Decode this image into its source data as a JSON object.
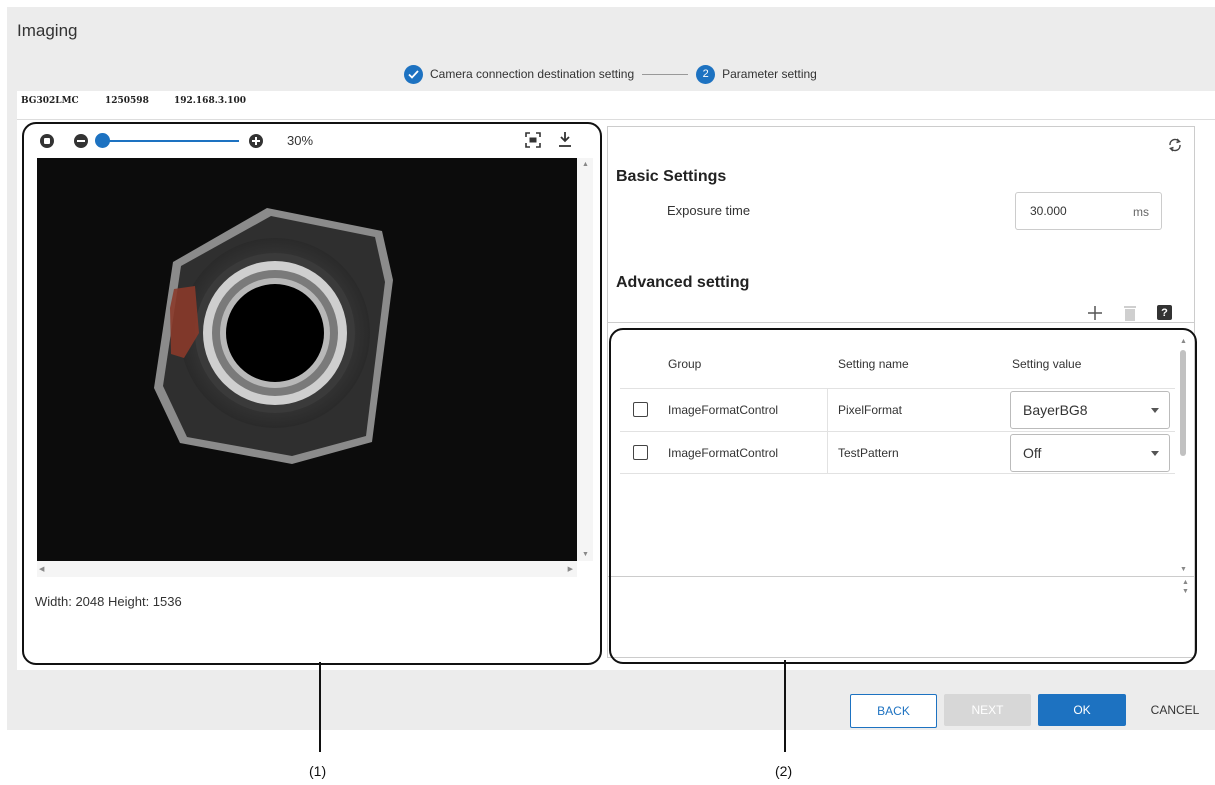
{
  "window": {
    "title": "Imaging"
  },
  "stepper": {
    "step1": {
      "label": "Camera connection destination setting"
    },
    "step2": {
      "number": "2",
      "label": "Parameter setting"
    }
  },
  "camera_info": {
    "model": "BG302LMC",
    "serial": "1250598",
    "ip": "192.168.3.100"
  },
  "viewer": {
    "zoom_label": "30%",
    "zoom_level_percent": 30,
    "dimensions_text": "Width: 2048 Height: 1536",
    "icons": [
      "stop-icon",
      "zoom-out-icon",
      "zoom-in-icon",
      "fit-to-screen-icon",
      "download-icon"
    ]
  },
  "settings": {
    "basic_title": "Basic Settings",
    "exposure_label": "Exposure time",
    "exposure_value": "30.000",
    "exposure_unit": "ms",
    "advanced_title": "Advanced setting",
    "icons": [
      "refresh-icon",
      "add-icon",
      "delete-icon",
      "help-icon"
    ]
  },
  "advanced_table": {
    "headers": {
      "group": "Group",
      "name": "Setting name",
      "value": "Setting value"
    },
    "rows": [
      {
        "group": "ImageFormatControl",
        "name": "PixelFormat",
        "value": "BayerBG8"
      },
      {
        "group": "ImageFormatControl",
        "name": "TestPattern",
        "value": "Off"
      }
    ]
  },
  "buttons": {
    "back": "BACK",
    "next": "NEXT",
    "ok": "OK",
    "cancel": "CANCEL"
  },
  "callouts": {
    "c1": "(1)",
    "c2": "(2)"
  },
  "colors": {
    "accent": "#1d72c1",
    "dialog_bg": "#ececec",
    "disabled": "#d7d7d7"
  }
}
